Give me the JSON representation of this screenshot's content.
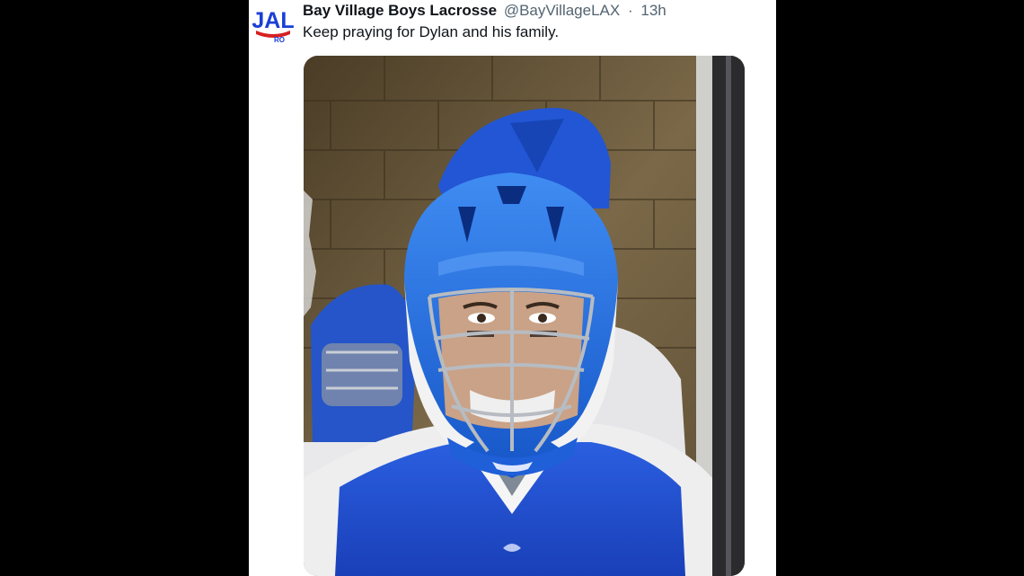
{
  "tweet": {
    "display_name": "Bay Village Boys Lacrosse",
    "handle": "@BayVillageLAX",
    "separator": "·",
    "timestamp": "13h",
    "text": "Keep praying for Dylan and his family.",
    "avatar": {
      "icon": "team-logo-icon",
      "logo_text": "JAL",
      "logo_subtext": "RO",
      "colors": {
        "primary": "#1a3fd6",
        "secondary": "#d62020"
      }
    },
    "media": {
      "icon": "photo-lacrosse-player",
      "colors": {
        "helmet_blue": "#1f6fe0",
        "jersey_blue": "#1f4fd0",
        "wall": "#6b5a3e"
      }
    }
  },
  "colors": {
    "page_background": "#000000",
    "card_background": "#ffffff",
    "primary_text": "#0f1419",
    "secondary_text": "#536471"
  }
}
